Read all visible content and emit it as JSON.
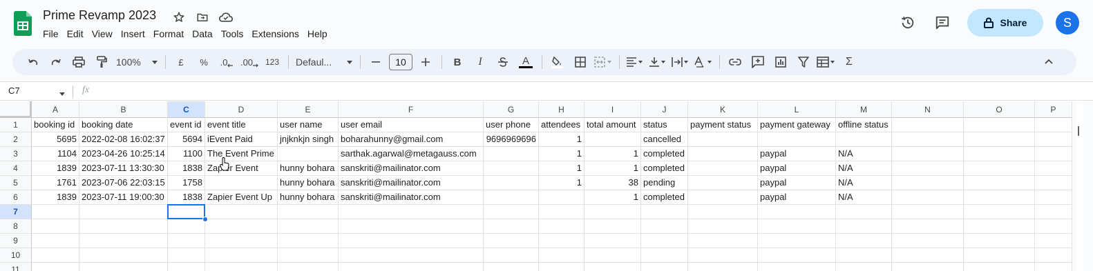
{
  "document": {
    "title": "Prime Revamp 2023"
  },
  "icons": {
    "app_logo": "google-sheets-logo",
    "star": "star-icon",
    "move": "move-to-folder-icon",
    "cloud": "cloud-saved-icon",
    "history": "version-history-icon",
    "comments": "comments-icon",
    "lock": "lock-icon"
  },
  "menu": [
    "File",
    "Edit",
    "View",
    "Insert",
    "Format",
    "Data",
    "Tools",
    "Extensions",
    "Help"
  ],
  "header": {
    "share_label": "Share",
    "avatar_letter": "S"
  },
  "toolbar": {
    "zoom": "100%",
    "currency": "£",
    "percent": "%",
    "dec_decrease": ".0",
    "dec_increase": ".00",
    "more_formats": "123",
    "font": "Defaul...",
    "font_size": "10",
    "bold": "B",
    "italic": "I",
    "text_color": "A",
    "sum": "Σ"
  },
  "formula_bar": {
    "name_box": "C7",
    "fx": "fx",
    "value": ""
  },
  "grid": {
    "columns": [
      "A",
      "B",
      "C",
      "D",
      "E",
      "F",
      "G",
      "H",
      "I",
      "J",
      "K",
      "L",
      "M",
      "N",
      "O",
      "P"
    ],
    "active_column": "C",
    "active_row": 7,
    "active_cell": "C7",
    "row_numbers": [
      "1",
      "2",
      "3",
      "4",
      "5",
      "6",
      "7",
      "8",
      "9",
      "10",
      "11"
    ],
    "headers": [
      "booking id",
      "booking date",
      "event id",
      "event title",
      "user name",
      "user email",
      "user phone",
      "attendees",
      "total amount",
      "status",
      "payment status",
      "payment gateway",
      "offline status"
    ],
    "rows": [
      [
        "5695",
        "2022-02-08 16:02:37",
        "5694",
        "iEvent Paid",
        "jnjknkjn singh",
        "boharahunny@gmail.com",
        "9696969696",
        "1",
        "",
        "cancelled",
        "",
        "",
        ""
      ],
      [
        "1104",
        "2023-04-26 10:25:14",
        "1100",
        "The Event Prime",
        "",
        "sarthak.agarwal@metagauss.com",
        "",
        "1",
        "1",
        "completed",
        "",
        "paypal",
        "N/A"
      ],
      [
        "1839",
        "2023-07-11 13:30:30",
        "1838",
        "Zapier Event",
        "hunny bohara",
        "sanskriti@mailinator.com",
        "",
        "1",
        "1",
        "completed",
        "",
        "paypal",
        "N/A"
      ],
      [
        "1761",
        "2023-07-06 22:03:15",
        "1758",
        "",
        "hunny bohara",
        "sanskriti@mailinator.com",
        "",
        "1",
        "38",
        "pending",
        "",
        "paypal",
        "N/A"
      ],
      [
        "1839",
        "2023-07-11 19:00:30",
        "1838",
        "Zapier Event Up",
        "hunny bohara",
        "sanskriti@mailinator.com",
        "",
        "",
        "1",
        "completed",
        "",
        "paypal",
        "N/A"
      ]
    ]
  },
  "colors": {
    "accent": "#1a73e8",
    "share_bg": "#c2e7ff",
    "toolbar_bg": "#edf2fa",
    "sheets_green": "#0f9d58"
  }
}
